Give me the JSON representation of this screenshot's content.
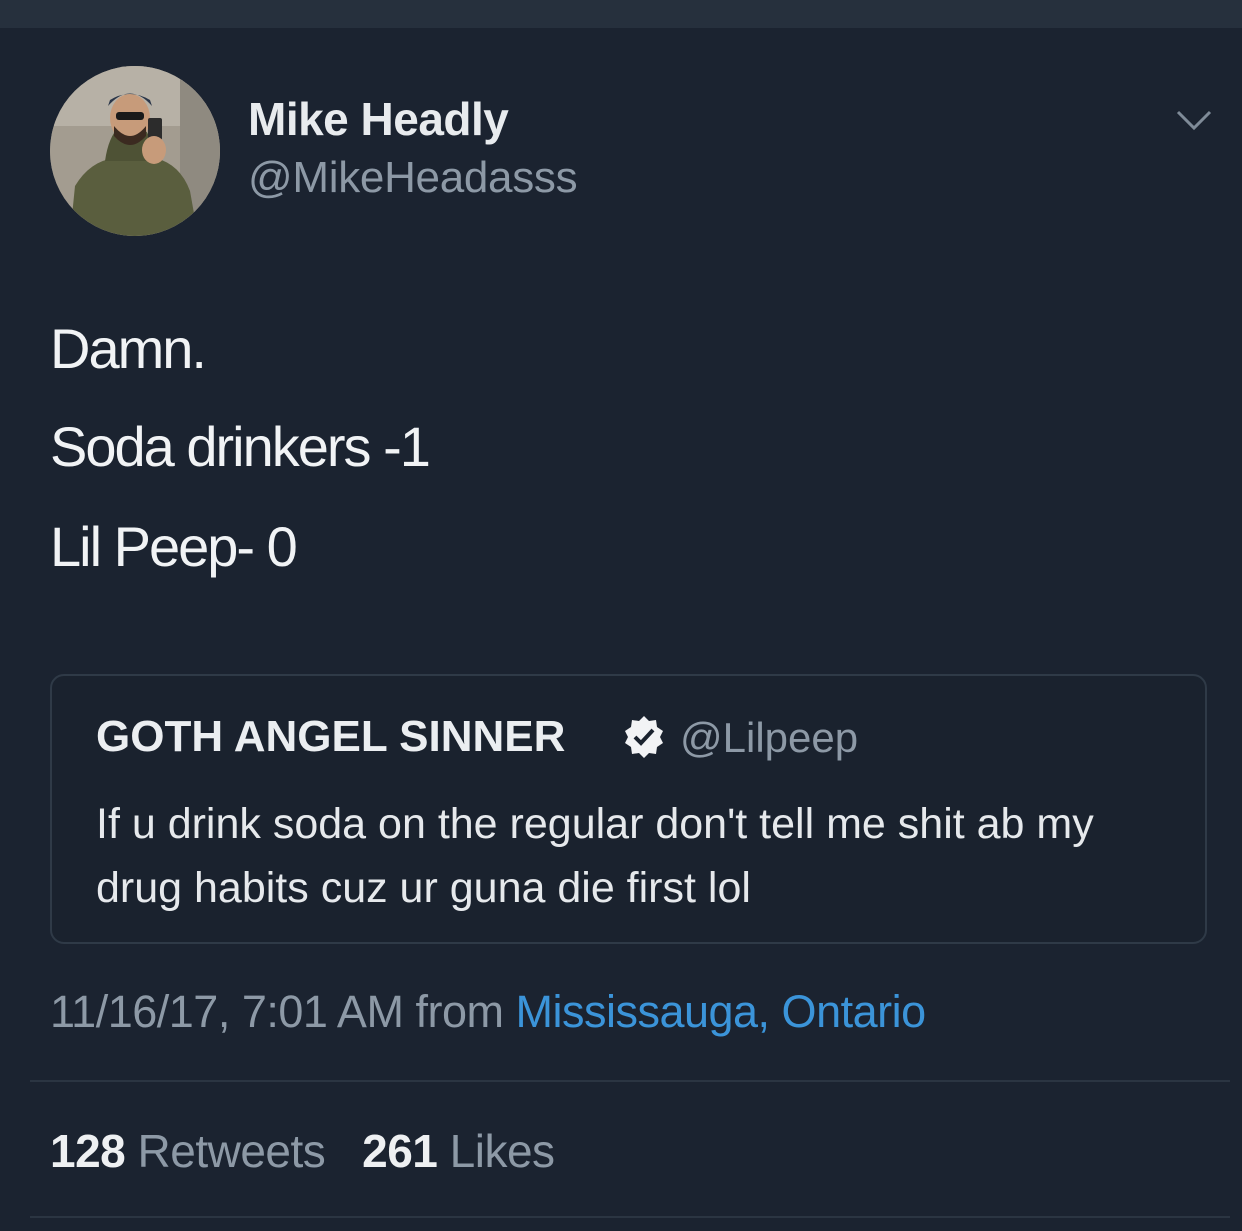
{
  "tweet": {
    "author": {
      "display_name": "Mike Headly",
      "handle": "@MikeHeadasss",
      "avatar_icon": "user-avatar-photo"
    },
    "menu_icon": "chevron-down-icon",
    "text_lines": [
      "Damn.",
      "Soda drinkers -1",
      "Lil Peep- 0"
    ],
    "quoted_tweet": {
      "display_name": "GOTH ANGEL SINNER",
      "verified_icon": "verified-badge-icon",
      "handle": "@Lilpeep",
      "text": "If u drink soda on the regular don't tell me shit ab my drug habits cuz ur guna die first lol"
    },
    "timestamp": "11/16/17, 7:01 AM",
    "from_label": "from",
    "location": "Mississauga, Ontario",
    "stats": {
      "retweets_count": "128",
      "retweets_label": "Retweets",
      "likes_count": "261",
      "likes_label": "Likes"
    },
    "colors": {
      "background": "#1b2330",
      "link": "#3b94d9",
      "secondary_text": "#8d99a6"
    }
  }
}
